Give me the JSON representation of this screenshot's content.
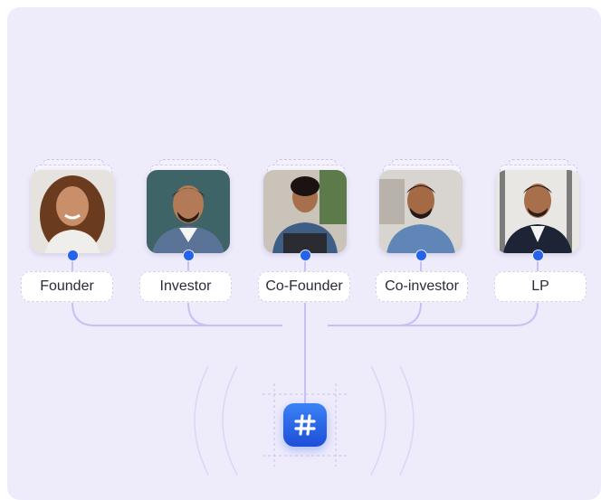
{
  "nodes": [
    {
      "id": "founder",
      "label": "Founder"
    },
    {
      "id": "investor",
      "label": "Investor"
    },
    {
      "id": "co-founder",
      "label": "Co-Founder"
    },
    {
      "id": "co-investor",
      "label": "Co-investor"
    },
    {
      "id": "lp",
      "label": "LP"
    }
  ],
  "hub": {
    "icon": "hash-icon"
  },
  "colors": {
    "background": "#eeebfb",
    "connector": "#c8c0f5",
    "accent": "#2563eb"
  }
}
